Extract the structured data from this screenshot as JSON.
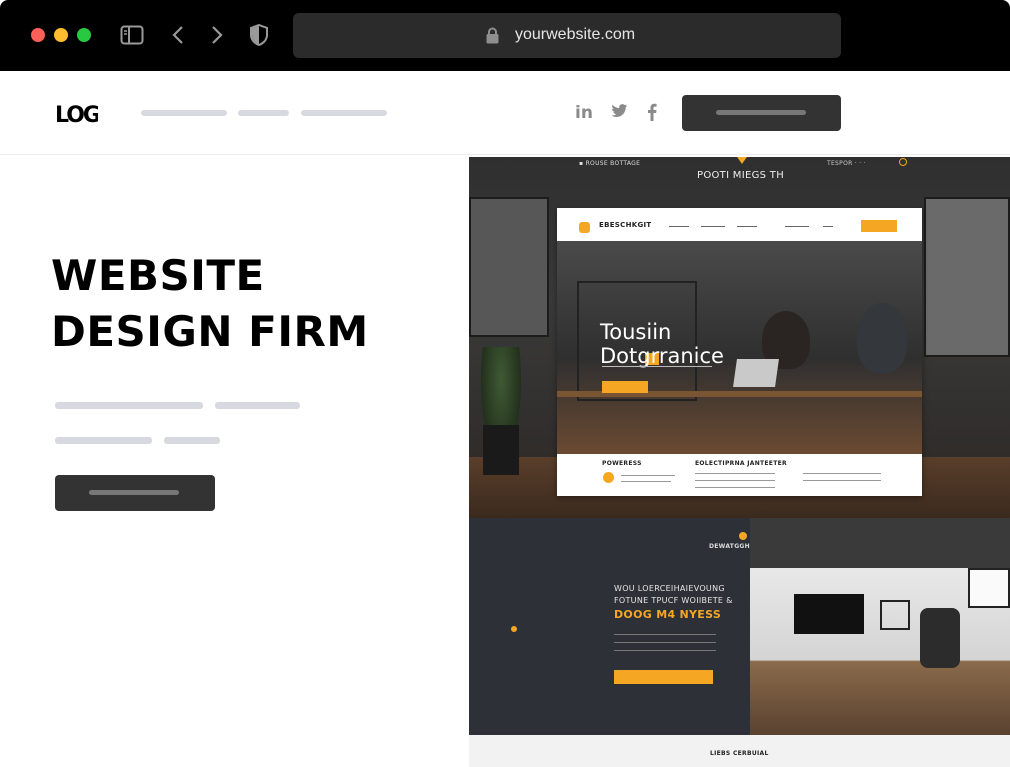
{
  "browser": {
    "url": "yourwebsite.com",
    "traffic_lights": [
      "#ff5f57",
      "#febc2e",
      "#28c840"
    ]
  },
  "nav": {
    "logo_text": "LOGO",
    "social": [
      "in",
      "t",
      "f"
    ]
  },
  "hero": {
    "title_line1": "WEBSITE",
    "title_line2": "DESIGN FIRM"
  },
  "mockup": {
    "top_center": "POOTI MIEGS TH",
    "card_brand": "EBESCHKGIT",
    "headline_line1": "Tousiin",
    "headline_line2": "Dotgrranice",
    "features_left": "POWERESS",
    "features_mid": "EOLECTIPRNA JANTEETER",
    "section_title": "DEWATGGHAEBS",
    "cta_line1": "WOU LOERCEIHAIEVOUNG",
    "cta_line2": "FOTUNE TPUCF WOIIBETE &",
    "cta_line3": "DOOG M4 NYESS",
    "footer_text": "LIEBS CERBUIAL"
  },
  "colors": {
    "accent": "#f5a623",
    "dark_button": "#333333",
    "placeholder": "#d8d8e0"
  }
}
